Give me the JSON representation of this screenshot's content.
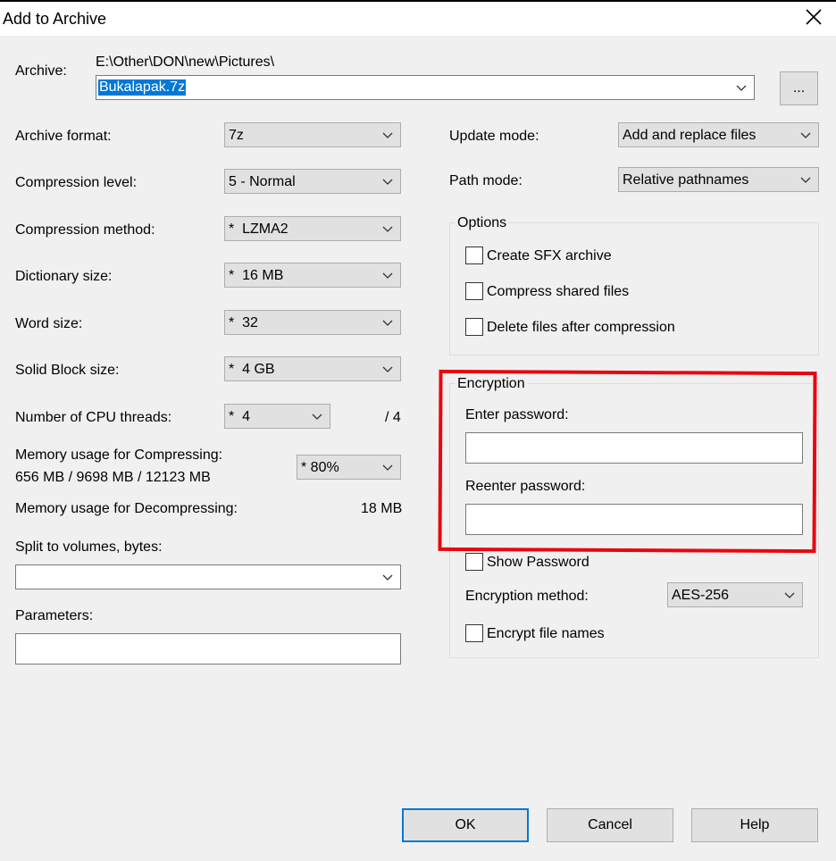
{
  "window": {
    "title": "Add to Archive"
  },
  "archive": {
    "label": "Archive:",
    "path": "E:\\Other\\DON\\new\\Pictures\\",
    "filename": "Bukalapak.7z",
    "browse_label": "..."
  },
  "left": {
    "archive_format": {
      "label": "Archive format:",
      "value": "7z"
    },
    "compression_level": {
      "label": "Compression level:",
      "value": "5 - Normal"
    },
    "compression_method": {
      "label": "Compression method:",
      "value": "*  LZMA2"
    },
    "dictionary_size": {
      "label": "Dictionary size:",
      "value": "*  16 MB"
    },
    "word_size": {
      "label": "Word size:",
      "value": "*  32"
    },
    "solid_block_size": {
      "label": "Solid Block size:",
      "value": "*  4 GB"
    },
    "cpu_threads": {
      "label": "Number of CPU threads:",
      "value": "*  4",
      "max": "/ 4"
    },
    "memory_compress": {
      "label": "Memory usage for Compressing:",
      "detail": "656 MB / 9698 MB / 12123 MB",
      "value": "* 80%"
    },
    "memory_decompress": {
      "label": "Memory usage for Decompressing:",
      "value": "18 MB"
    },
    "split_volumes": {
      "label": "Split to volumes, bytes:",
      "value": ""
    },
    "parameters": {
      "label": "Parameters:",
      "value": ""
    }
  },
  "right": {
    "update_mode": {
      "label": "Update mode:",
      "value": "Add and replace files"
    },
    "path_mode": {
      "label": "Path mode:",
      "value": "Relative pathnames"
    },
    "options": {
      "title": "Options",
      "create_sfx": "Create SFX archive",
      "compress_shared": "Compress shared files",
      "delete_after": "Delete files after compression"
    },
    "encryption": {
      "title": "Encryption",
      "enter_password": "Enter password:",
      "reenter_password": "Reenter password:",
      "show_password": "Show Password",
      "method_label": "Encryption method:",
      "method_value": "AES-256",
      "encrypt_names": "Encrypt file names"
    }
  },
  "buttons": {
    "ok": "OK",
    "cancel": "Cancel",
    "help": "Help"
  },
  "colors": {
    "highlight": "#e8070f",
    "selection": "#0078d7",
    "default_button_border": "#0078d7"
  }
}
